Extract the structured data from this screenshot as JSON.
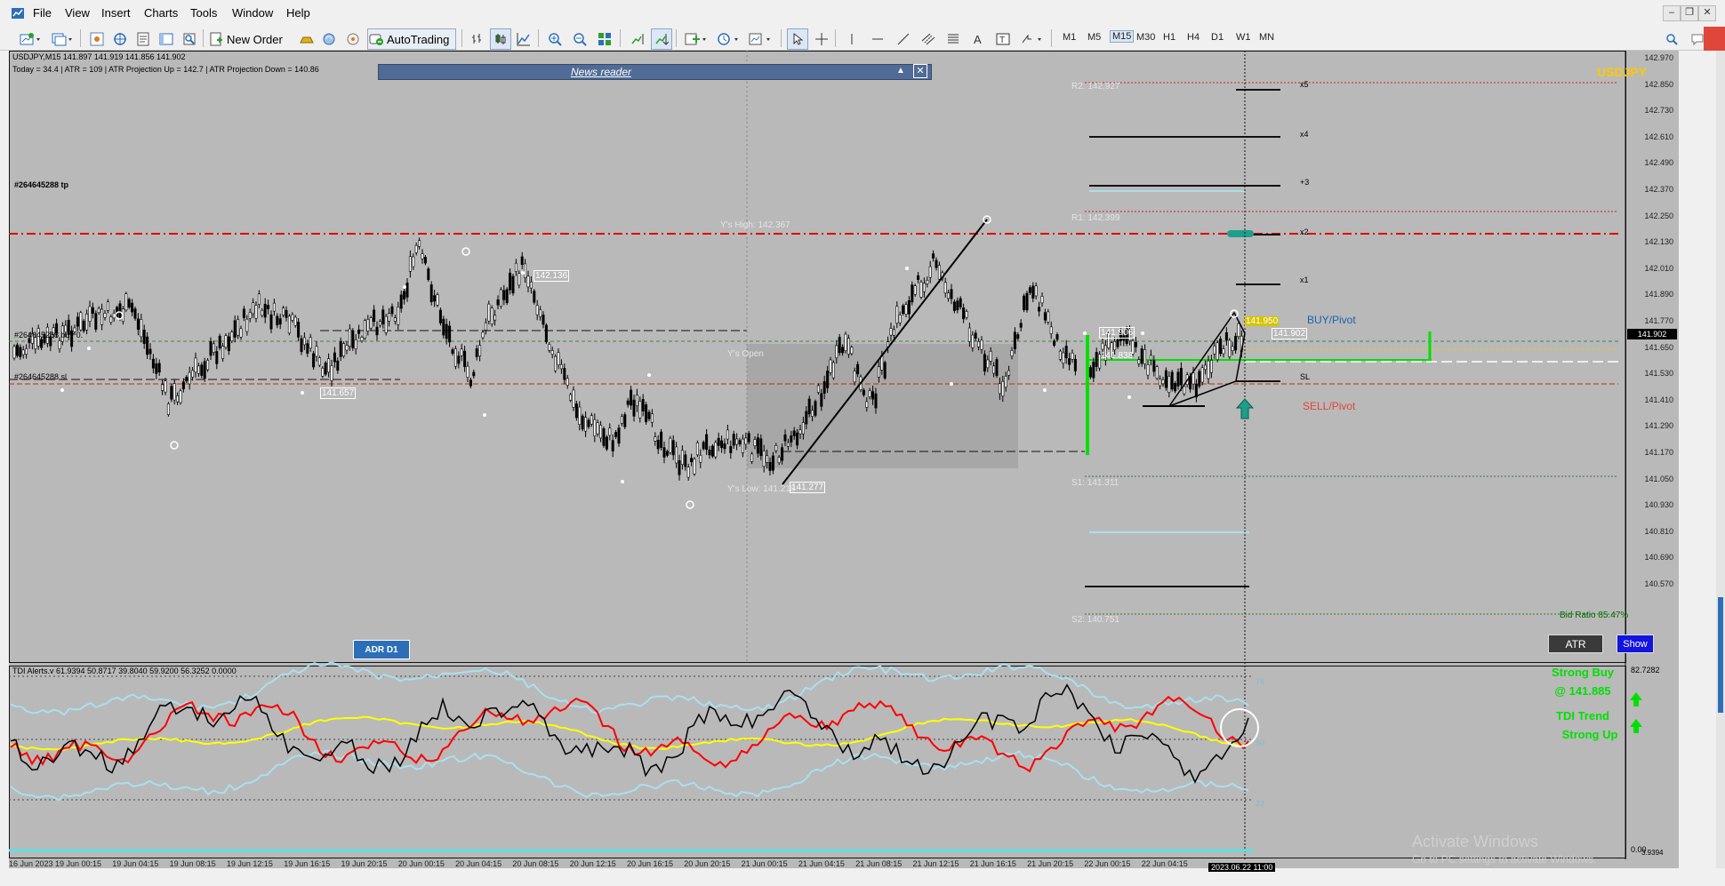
{
  "menu": [
    "File",
    "View",
    "Insert",
    "Charts",
    "Tools",
    "Window",
    "Help"
  ],
  "toolbar": {
    "new_order": "New Order",
    "autotrading": "AutoTrading",
    "timeframes": [
      "M1",
      "M5",
      "M15",
      "M30",
      "H1",
      "H4",
      "D1",
      "W1",
      "MN"
    ],
    "active_timeframe": "M15"
  },
  "chart": {
    "symbol_info": "USDJPY,M15  141.897 141.919 141.856 141.902",
    "atr_info": "Today = 34.4   |   ATR = 109   |   ATR Projection Up = 142.7   |   ATR Projection Down = 140.86",
    "symbol_label": "USDJPY",
    "news_reader": "News reader",
    "order_tp": "#264645288 tp",
    "order_buy": "#264645288 buy 0.",
    "order_sl": "#264645288 sl",
    "ys_high": "Y's High: 142.367",
    "ys_low": "Y's Low: 141.218",
    "ys_open": "Y's Open",
    "price_tag_1": "142.136",
    "price_tag_2": "141.657",
    "price_tag_3": "141.277",
    "price_tag_4": "141.906",
    "price_tag_5": "141.838",
    "price_tag_6": "141.950",
    "price_tag_7": "141.902",
    "r2": "R2: 142.927",
    "r1": "R1: 142.399",
    "s1": "S1: 141.311",
    "s2": "S2: 140.751",
    "x5": "x5",
    "x4": "x4",
    "x3": "+3",
    "x2": "x2",
    "x1": "x1",
    "sl": "SL",
    "buy_pivot": "BUY/Pivot",
    "sell_pivot": "SELL/Pivot",
    "bid_ratio": "Bid Ratio 85.47%",
    "adr": "ADR D1",
    "atr_button": "ATR",
    "show_button": "Show",
    "current_price": "141.902",
    "price_ticks": [
      "142.970",
      "142.850",
      "142.730",
      "142.610",
      "142.490",
      "142.370",
      "142.250",
      "142.130",
      "142.010",
      "141.890",
      "141.770",
      "141.650",
      "141.530",
      "141.410",
      "141.290",
      "141.170",
      "141.050",
      "140.930",
      "140.810",
      "140.690",
      "140.570"
    ]
  },
  "indicator": {
    "title": "TDI Alerts.v 61.9394 50.8717 39.8040 59.9200 56.3252 0.0000",
    "level_78": "78",
    "level_50": "50",
    "level_23": "23",
    "axis_top": "82.7282",
    "axis_bottom": "0.00",
    "axis_bottom2": "3.9394",
    "strong_buy": "Strong Buy",
    "strong_buy_price": "@ 141.885",
    "tdi_trend": "TDI Trend",
    "strong_up": "Strong Up"
  },
  "time_axis": [
    "16 Jun 2023",
    "19 Jun 00:15",
    "19 Jun 04:15",
    "19 Jun 08:15",
    "19 Jun 12:15",
    "19 Jun 16:15",
    "19 Jun 20:15",
    "20 Jun 00:15",
    "20 Jun 04:15",
    "20 Jun 08:15",
    "20 Jun 12:15",
    "20 Jun 16:15",
    "20 Jun 20:15",
    "21 Jun 00:15",
    "21 Jun 04:15",
    "21 Jun 08:15",
    "21 Jun 12:15",
    "21 Jun 16:15",
    "21 Jun 20:15",
    "22 Jun 00:15",
    "22 Jun 04:15"
  ],
  "time_cursor": "2023.06.22 11:00",
  "watermark": {
    "line1": "Activate Windows",
    "line2": "Go to PC settings to activate Windows."
  },
  "colors": {
    "chart_bg": "#b9b9b9",
    "tp_line": "#e00000",
    "buy_green": "#00e000",
    "tdi_red": "#ff0000",
    "tdi_yellow": "#ffff00",
    "band_blue": "#aadfee",
    "gold": "#ffc800"
  }
}
